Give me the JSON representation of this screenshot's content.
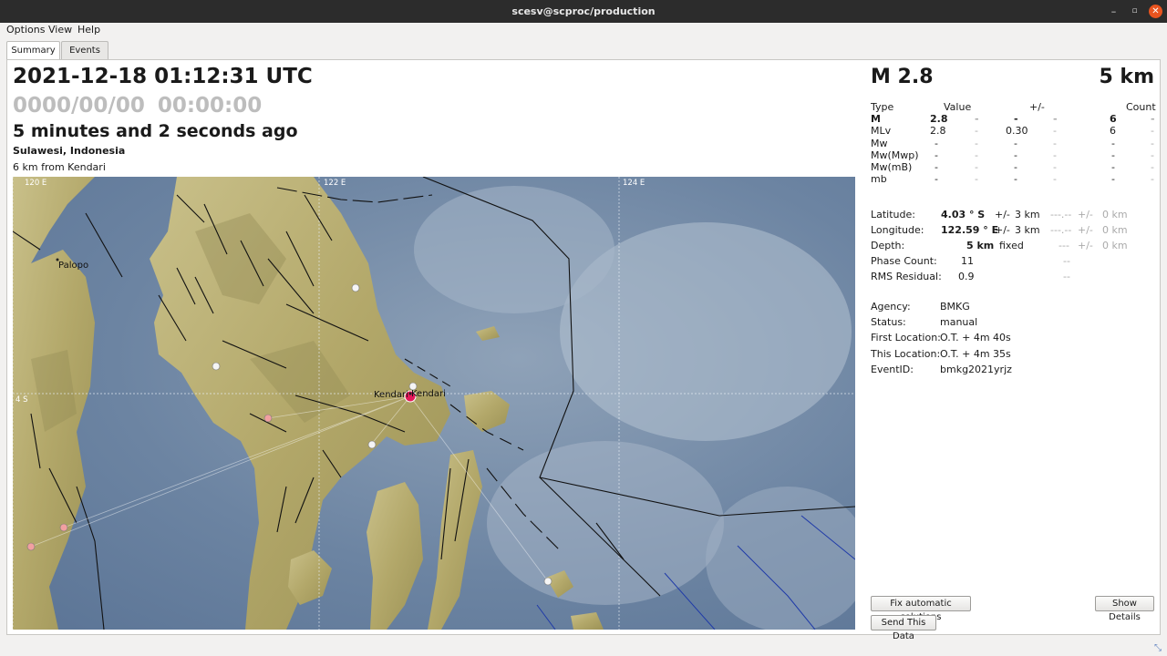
{
  "window": {
    "title": "scesv@scproc/production"
  },
  "menu": [
    "Options",
    "View",
    "Help"
  ],
  "tabs": [
    {
      "label": "Summary",
      "active": true
    },
    {
      "label": "Events",
      "active": false
    }
  ],
  "summary": {
    "origin_time": "2021-12-18 01:12:31 UTC",
    "current_time": "0000/00/00  00:00:00",
    "time_ago": "5 minutes and 2 seconds ago",
    "region": "Sulawesi, Indonesia",
    "nearest_city": "6 km from Kendari"
  },
  "map": {
    "grid_labels": [
      "120 E",
      "122 E",
      "124 E",
      "4 S"
    ],
    "city_labels": [
      "Palopo",
      "Kendari",
      "Kendari"
    ]
  },
  "magnitude": {
    "headline": "M 2.8",
    "depth_headline": "5 km",
    "header": [
      "Type",
      "Value",
      "+/-",
      "Count"
    ],
    "rows": [
      {
        "type": "M",
        "value": "2.8",
        "uncertainty": "-",
        "count": "6",
        "bold": true
      },
      {
        "type": "MLv",
        "value": "2.8",
        "uncertainty": "0.30",
        "count": "6",
        "bold": false
      },
      {
        "type": "Mw",
        "value": "-",
        "uncertainty": "-",
        "count": "-",
        "bold": false
      },
      {
        "type": "Mw(Mwp)",
        "value": "-",
        "uncertainty": "-",
        "count": "-",
        "bold": false
      },
      {
        "type": "Mw(mB)",
        "value": "-",
        "uncertainty": "-",
        "count": "-",
        "bold": false
      },
      {
        "type": "mb",
        "value": "-",
        "uncertainty": "-",
        "count": "-",
        "bold": false
      }
    ],
    "sep": "-"
  },
  "location": {
    "latitude_label": "Latitude:",
    "latitude": "4.03 ° S",
    "latitude_pm": "+/-",
    "latitude_err": "3 km",
    "longitude_label": "Longitude:",
    "longitude": "122.59 ° E",
    "longitude_pm": "+/-",
    "longitude_err": "3 km",
    "depth_label": "Depth:",
    "depth": "5 km",
    "depth_type": "fixed",
    "prev_lat": "---.--",
    "prev_lon": "---.--",
    "prev_depth": "---",
    "prev_pm": "+/-",
    "prev_err": "0 km",
    "phase_label": "Phase Count:",
    "phase_count": "11",
    "phase_prev": "--",
    "rms_label": "RMS Residual:",
    "rms": "0.9",
    "rms_prev": "--"
  },
  "details": {
    "agency_label": "Agency:",
    "agency": "BMKG",
    "status_label": "Status:",
    "status": "manual",
    "first_label": "First Location:",
    "first": "O.T. + 4m 40s",
    "this_label": "This Location:",
    "this": "O.T. + 4m 35s",
    "event_label": "EventID:",
    "event": "bmkg2021yrjz"
  },
  "buttons": {
    "fix": "Fix automatic solutions",
    "show": "Show Details",
    "send": "Send This Data"
  }
}
